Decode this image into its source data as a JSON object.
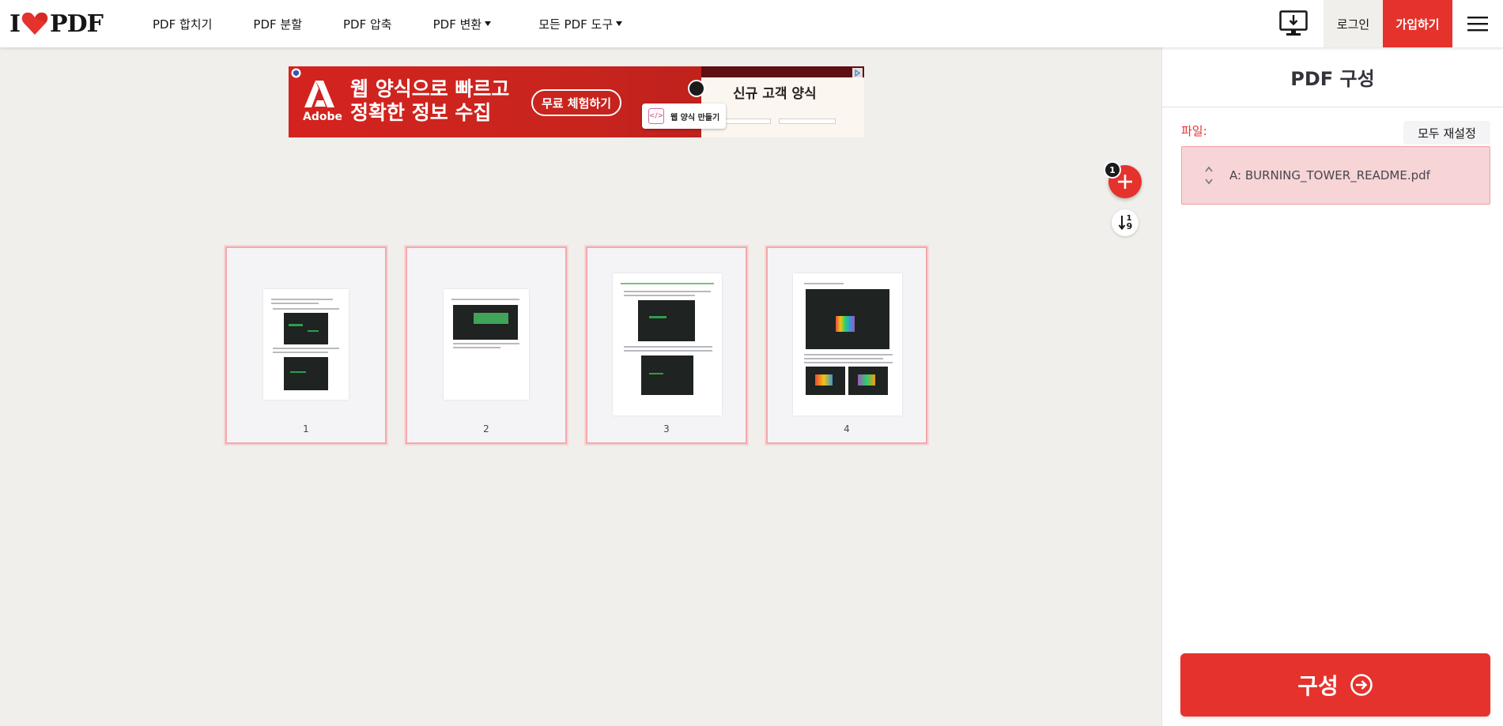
{
  "header": {
    "logo_left": "I",
    "logo_right": "PDF",
    "nav": [
      {
        "label": "PDF 합치기"
      },
      {
        "label": "PDF 분할"
      },
      {
        "label": "PDF 압축"
      },
      {
        "label": "PDF 변환"
      },
      {
        "label": "모든 PDF 도구"
      }
    ],
    "login_label": "로그인",
    "signup_label": "가입하기"
  },
  "ad": {
    "brand": "Adobe",
    "headline_line1": "웹 양식으로 빠르고",
    "headline_line2": "정확한 정보 수집",
    "cta": "무료 체험하기",
    "panel_title": "신규 고객 양식",
    "chip_label": "웹 양식 만들기"
  },
  "toolbar": {
    "add_badge": "1",
    "sort_top": "1",
    "sort_bottom": "9"
  },
  "pages": [
    {
      "number": "1"
    },
    {
      "number": "2"
    },
    {
      "number": "3"
    },
    {
      "number": "4"
    }
  ],
  "sidebar": {
    "title": "PDF 구성",
    "files_label": "파일:",
    "reset_label": "모두 재설정",
    "files": [
      {
        "name": "A: BURNING_TOWER_README.pdf"
      }
    ],
    "submit_label": "구성"
  },
  "colors": {
    "brand_red": "#e5322d",
    "page_bg": "#f0efeb",
    "file_row": "#f7d4d6"
  }
}
